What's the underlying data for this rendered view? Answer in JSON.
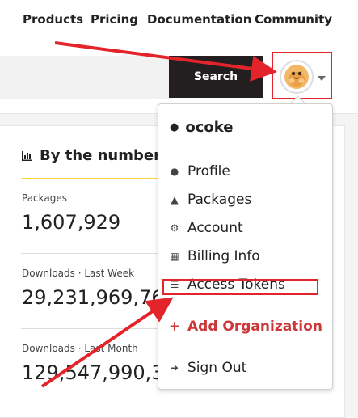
{
  "nav": {
    "items": [
      "Products",
      "Pricing",
      "Documentation",
      "Community"
    ]
  },
  "search": {
    "placeholder": "",
    "button_label": "Search"
  },
  "stats": {
    "heading": "By the numbers",
    "blocks": [
      {
        "label": "Packages",
        "value": "1,607,929"
      },
      {
        "label": "Downloads · Last Week",
        "value": "29,231,969,76"
      },
      {
        "label": "Downloads · Last Month",
        "value": "129,547,990,3"
      }
    ]
  },
  "dropdown": {
    "username": "ocoke",
    "items": [
      {
        "label": "Profile",
        "icon": "user-icon"
      },
      {
        "label": "Packages",
        "icon": "packages-icon"
      },
      {
        "label": "Account",
        "icon": "gear-icon"
      },
      {
        "label": "Billing Info",
        "icon": "credit-card-icon"
      },
      {
        "label": "Access Tokens",
        "icon": "coins-icon"
      }
    ],
    "add_org": {
      "plus": "+",
      "label": "Add Organization"
    },
    "sign_out": "Sign Out"
  },
  "colors": {
    "annotation_red": "#e3242b",
    "npm_red": "#cb3837",
    "accent_yellow": "#fbd834",
    "search_button_bg": "#231f20"
  }
}
